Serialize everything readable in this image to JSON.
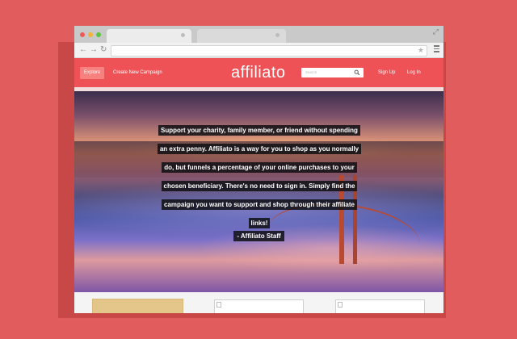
{
  "nav": {
    "explore": "Explore",
    "create_campaign": "Create New Campaign",
    "logo": "affiliato",
    "search_placeholder": "Search",
    "sign_up": "Sign Up",
    "log_in": "Log In"
  },
  "hero": {
    "quote_lines": [
      "Support your charity, family member, or friend without spending",
      "an extra penny. Affiliato is a way for you to shop as you normally",
      "do, but funnels a percentage of your online purchases to your",
      "chosen beneficiary. There's no need to sign in. Simply find the",
      "campaign you want to support and shop through their affiliate",
      "links!"
    ],
    "credit": "- Affiliato Staff"
  },
  "icons": {
    "back": "arrow-left-icon",
    "forward": "arrow-right-icon",
    "reload": "reload-icon",
    "bookmark": "star-icon",
    "menu": "hamburger-menu-icon",
    "search": "search-icon",
    "fullscreen": "expand-icon"
  },
  "colors": {
    "background": "#e15c5c",
    "brand": "#ee5256",
    "explore_active": "#f6817e"
  }
}
